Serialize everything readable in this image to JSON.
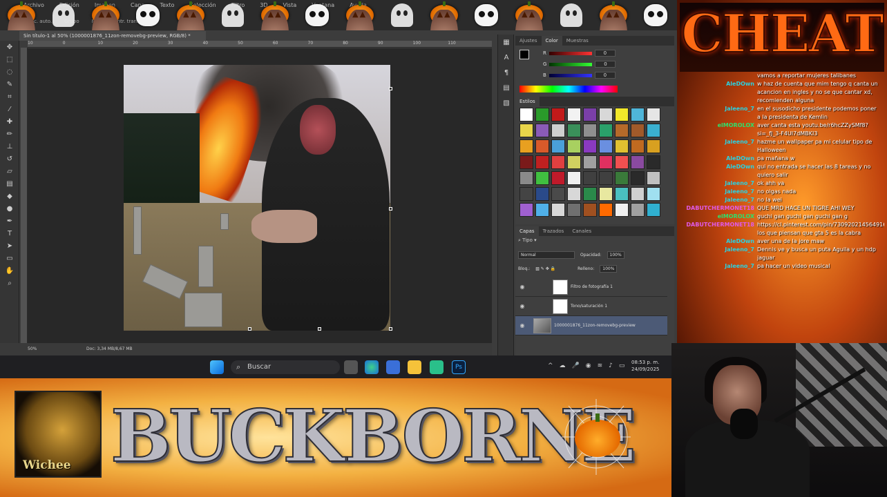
{
  "photoshop": {
    "menu": [
      "Archivo",
      "Edición",
      "Imagen",
      "Capa",
      "Texto",
      "Selección",
      "Filtro",
      "3D",
      "Vista",
      "Ventana",
      "Ayuda"
    ],
    "options": [
      "Selec. auto.",
      "Grupo",
      "Mostrar contr. transf."
    ],
    "document_tab": "Sin título-1 al 50% (1000001876_11zon-removebg-preview, RGB/8) *",
    "ruler_marks": [
      "10",
      "0",
      "10",
      "20",
      "30",
      "40",
      "50",
      "60",
      "70",
      "80",
      "90",
      "100",
      "110"
    ],
    "zoom": "50%",
    "doc_info": "Doc: 3,34 MB/8,67 MB"
  },
  "color_panel": {
    "tabs": [
      "Ajustes",
      "Color",
      "Muestras"
    ],
    "active_tab": "Color",
    "channels": [
      {
        "label": "R",
        "value": "0"
      },
      {
        "label": "G",
        "value": "0"
      },
      {
        "label": "B",
        "value": "0"
      }
    ]
  },
  "styles_panel": {
    "tab": "Estilos",
    "swatch_colors": [
      "#ffffff",
      "#2a9b2a",
      "#c21a1a",
      "#f2f2f2",
      "#7a3fa8",
      "#d8d8d8",
      "#f2e82a",
      "#4fb5d9",
      "#e6e6e6",
      "#e8d54a",
      "#8a5bb8",
      "#cfcfcf",
      "#3a8f5a",
      "#8f8f8f",
      "#2aa06a",
      "#b56a2a",
      "#a05a2a",
      "#3ab0d0",
      "#e8a020",
      "#d85a2a",
      "#4aa0d8",
      "#a8d060",
      "#8a3ac0",
      "#6a8fe0",
      "#e0c030",
      "#c06a20",
      "#d8a020",
      "#7a1a1a",
      "#c02020",
      "#e04040",
      "#d0d060",
      "#a0a0a0",
      "#e03060",
      "#f05050",
      "#8a4aa0",
      "#2a2a2a",
      "#8a8a8a",
      "#40c040",
      "#c01a2a",
      "#f0f0f0",
      "#404040",
      "#404040",
      "#3a7a3a",
      "#2a2a2a",
      "#c0c0c0",
      "#444444",
      "#2a4a8a",
      "#4a4a4a",
      "#d8d8d8",
      "#2a8a4a",
      "#e8e8a0",
      "#4ac0c0",
      "#d0d0d0",
      "#a0e0f0",
      "#a060d0",
      "#50b0e8",
      "#d8d8d8",
      "#707070",
      "#a05020",
      "#ff6a00",
      "#f0f0f0",
      "#a0a0a0",
      "#30b0d0"
    ]
  },
  "layers_panel": {
    "tabs": [
      "Capas",
      "Trazados",
      "Canales"
    ],
    "kind_label": "Tipo",
    "blend_mode": "Normal",
    "opacity_label": "Opacidad:",
    "opacity": "100%",
    "lock_label": "Bloq.:",
    "fill_label": "Relleno:",
    "fill": "100%",
    "layers": [
      {
        "name": "Filtro de fotografía 1",
        "selected": false
      },
      {
        "name": "Tono/saturación 1",
        "selected": false
      },
      {
        "name": "1000001876_11zon-removebg-preview",
        "selected": true
      }
    ]
  },
  "taskbar": {
    "search_placeholder": "Buscar",
    "time": "08:53 p. m.",
    "date": "24/09/2025"
  },
  "banner": {
    "logo_text": "Wichee",
    "title": "BUCKBORNE"
  },
  "overlay": {
    "title": "CHEAT"
  },
  "chat": [
    {
      "user": "",
      "color": "#2ad1e0",
      "text": "vamos a reportar mujeres talibanes"
    },
    {
      "user": "AleDOwn",
      "color": "#2ad1e0",
      "text": "w haz de cuenta que mim tengo q canta un acancion en ingles y no se que cantar xd, recomienden alguna"
    },
    {
      "user": "Jaleeno_7",
      "color": "#2ad1e0",
      "text": "en el susodicho presidente podemos poner a la presidenta de Kemlin"
    },
    {
      "user": "elMOROLOX",
      "color": "#2ee06b",
      "text": "aver canta esta youtu.be/r6hcZZySMf8?si=_fJ_3-F4UI7dMBKI3"
    },
    {
      "user": "Jaleeno_7",
      "color": "#2ad1e0",
      "text": "hazme un wallpaper pa mi celular tipo de Halloween"
    },
    {
      "user": "AleDOwn",
      "color": "#2ad1e0",
      "text": "pa mañana w"
    },
    {
      "user": "AleDOwn",
      "color": "#2ad1e0",
      "text": "qui no entrada se hacer las 8 tareas y no quiero salir"
    },
    {
      "user": "Jaleeno_7",
      "color": "#2ad1e0",
      "text": "ok ahh va"
    },
    {
      "user": "Jaleeno_7",
      "color": "#2ad1e0",
      "text": "no oigas nada"
    },
    {
      "user": "Jaleeno_7",
      "color": "#2ad1e0",
      "text": "no la wei"
    },
    {
      "user": "DABUTCHERMONET18",
      "color": "#e05ae8",
      "text": "QUE MRD HACE UN TIGRE AHI WEY"
    },
    {
      "user": "elMOROLOX",
      "color": "#2ee06b",
      "text": "guchi gan guchi gan guchi gan g"
    },
    {
      "user": "DABUTCHERMONET18",
      "color": "#e05ae8",
      "text": "https://cl.pinterest.com/pin/730920214564916659 los que piensan que gta 5 es la cabra"
    },
    {
      "user": "AleDOwn",
      "color": "#2ad1e0",
      "text": "aver una de la jore maw"
    },
    {
      "user": "Jaleeno_7",
      "color": "#2ad1e0",
      "text": "Dennis ve y busca un puta Aguila y un hdp jaguar"
    },
    {
      "user": "Jaleeno_7",
      "color": "#2ad1e0",
      "text": "pa hacer un video musical"
    }
  ],
  "colors": {
    "ps_bg": "#3c3c3c",
    "banner_orange": "#f3b142",
    "selected_layer": "#4c5a76"
  }
}
